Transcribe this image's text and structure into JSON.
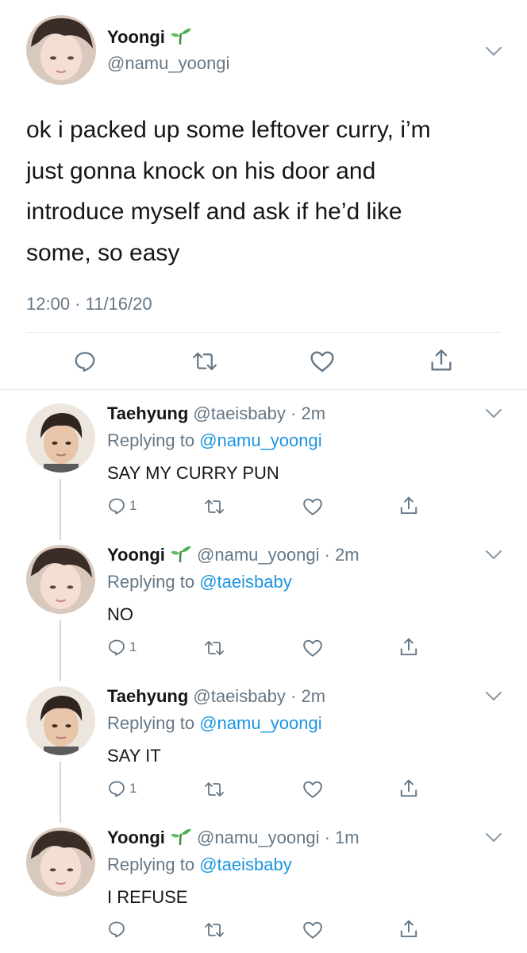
{
  "main_tweet": {
    "name": "Yoongi",
    "handle": "@namu_yoongi",
    "text_lines": [
      "ok i packed up some leftover curry, i’m",
      "just gonna knock on his door and",
      "introduce myself and ask if he’d like",
      "some, so easy"
    ],
    "timestamp": "12:00 · 11/16/20"
  },
  "replies": [
    {
      "name": "Taehyung",
      "handle": "@taeisbaby",
      "time": "· 2m",
      "replying_prefix": "Replying to",
      "replying_to": "@namu_yoongi",
      "text": "SAY MY CURRY PUN",
      "reply_count": "1"
    },
    {
      "name": "Yoongi",
      "handle": "@namu_yoongi",
      "time": "· 2m",
      "replying_prefix": "Replying to",
      "replying_to": "@taeisbaby",
      "text": "NO",
      "reply_count": "1"
    },
    {
      "name": "Taehyung",
      "handle": "@taeisbaby",
      "time": "· 2m",
      "replying_prefix": "Replying to",
      "replying_to": "@namu_yoongi",
      "text": "SAY IT",
      "reply_count": "1"
    },
    {
      "name": "Yoongi",
      "handle": "@namu_yoongi",
      "time": "· 1m",
      "replying_prefix": "Replying to",
      "replying_to": "@taeisbaby",
      "text": "I REFUSE",
      "reply_count": ""
    }
  ],
  "colors": {
    "text": "#14171a",
    "muted": "#657786",
    "link": "#1b95e0",
    "divider": "#e6ecf0",
    "thread_line": "#ccd6dd",
    "sprout": "#4caf50"
  },
  "icons": [
    "reply-icon",
    "retweet-icon",
    "like-icon",
    "share-icon",
    "chevron-down-icon",
    "sprout-emoji"
  ]
}
